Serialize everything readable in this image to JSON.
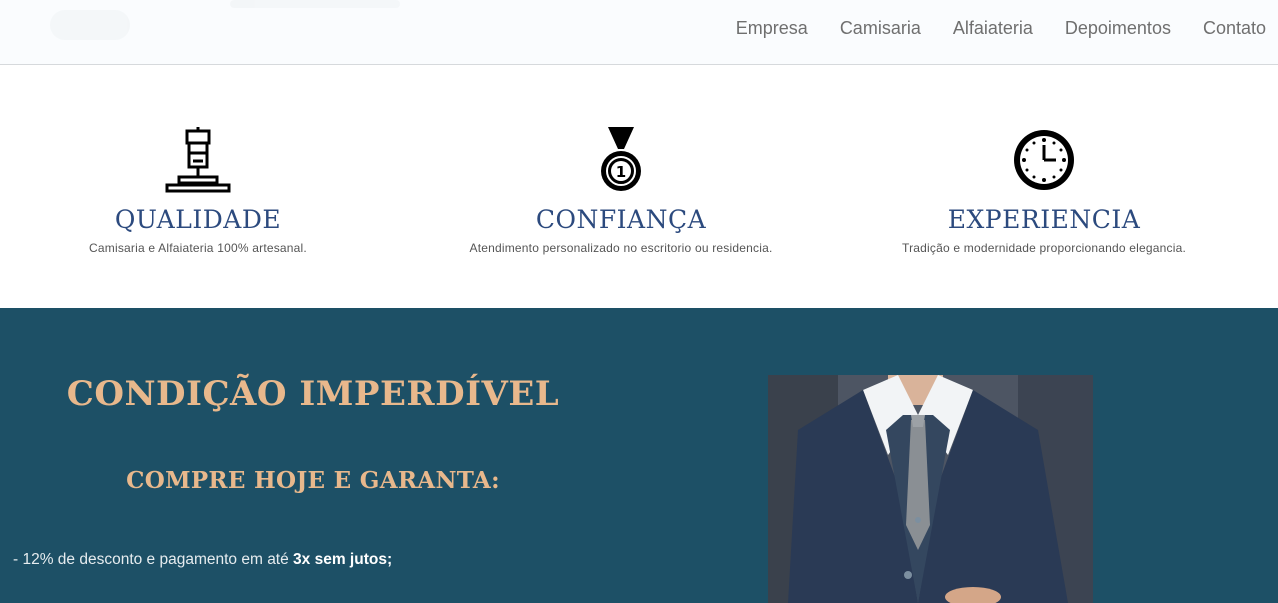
{
  "nav": {
    "items": [
      "Empresa",
      "Camisaria",
      "Alfaiateria",
      "Depoimentos",
      "Contato"
    ]
  },
  "features": [
    {
      "icon": "sewing-machine-icon",
      "title": "QUALIDADE",
      "text": "Camisaria e Alfaiateria 100% artesanal."
    },
    {
      "icon": "medal-icon",
      "title": "CONFIANÇA",
      "text": "Atendimento personalizado no escritorio ou residencia."
    },
    {
      "icon": "clock-icon",
      "title": "EXPERIENCIA",
      "text": "Tradição e modernidade proporcionando elegancia."
    }
  ],
  "promo": {
    "title": "CONDIÇÃO IMPERDÍVEL",
    "subtitle": "COMPRE HOJE E GARANTA:",
    "line_prefix": "- 12% de desconto e pagamento em até ",
    "line_bold": "3x sem jutos;",
    "image": "suit-man-photo"
  },
  "colors": {
    "accent": "#e8b88c",
    "heading": "#2c4a7e",
    "promo_bg": "#1d5066"
  }
}
